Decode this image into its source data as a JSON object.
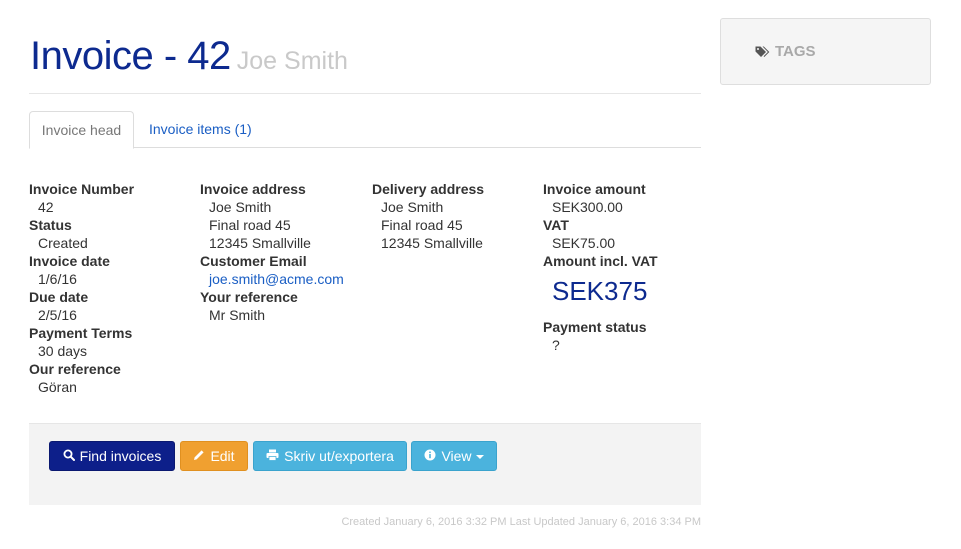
{
  "header": {
    "title": "Invoice - 42",
    "subtitle": "Joe Smith"
  },
  "tabs": [
    {
      "label": "Invoice head",
      "active": true
    },
    {
      "label": "Invoice items (1)",
      "active": false
    }
  ],
  "invoice": {
    "number_label": "Invoice Number",
    "number": "42",
    "status_label": "Status",
    "status": "Created",
    "date_label": "Invoice date",
    "date": "1/6/16",
    "due_label": "Due date",
    "due": "2/5/16",
    "terms_label": "Payment Terms",
    "terms": "30 days",
    "our_ref_label": "Our reference",
    "our_ref": "Göran"
  },
  "invoice_address": {
    "label": "Invoice address",
    "name": "Joe Smith",
    "street": "Final road 45",
    "city": "12345 Smallville",
    "email_label": "Customer Email",
    "email": "joe.smith@acme.com",
    "your_ref_label": "Your reference",
    "your_ref": "Mr Smith"
  },
  "delivery_address": {
    "label": "Delivery address",
    "name": "Joe Smith",
    "street": "Final road 45",
    "city": "12345 Smallville"
  },
  "amounts": {
    "amount_label": "Invoice amount",
    "amount": "SEK300.00",
    "vat_label": "VAT",
    "vat": "SEK75.00",
    "total_label": "Amount incl. VAT",
    "total": "SEK375",
    "payment_status_label": "Payment status",
    "payment_status": "?"
  },
  "actions": {
    "find": "Find invoices",
    "edit": "Edit",
    "print": "Skriv ut/exportera",
    "view": "View"
  },
  "icons": {
    "find": "search-icon",
    "edit": "pencil-icon",
    "print": "printer-icon",
    "view": "info-circle-icon",
    "tags": "tags-icon"
  },
  "footer": {
    "meta": "Created January 6, 2016 3:32 PM Last Updated January 6, 2016 3:34 PM"
  },
  "tags_panel": {
    "title": "TAGS"
  },
  "colors": {
    "title": "#0d2a8f",
    "link": "#1a5ec4",
    "primary": "#0d1f8a",
    "warning": "#f0a030",
    "info": "#4bb3dd"
  }
}
